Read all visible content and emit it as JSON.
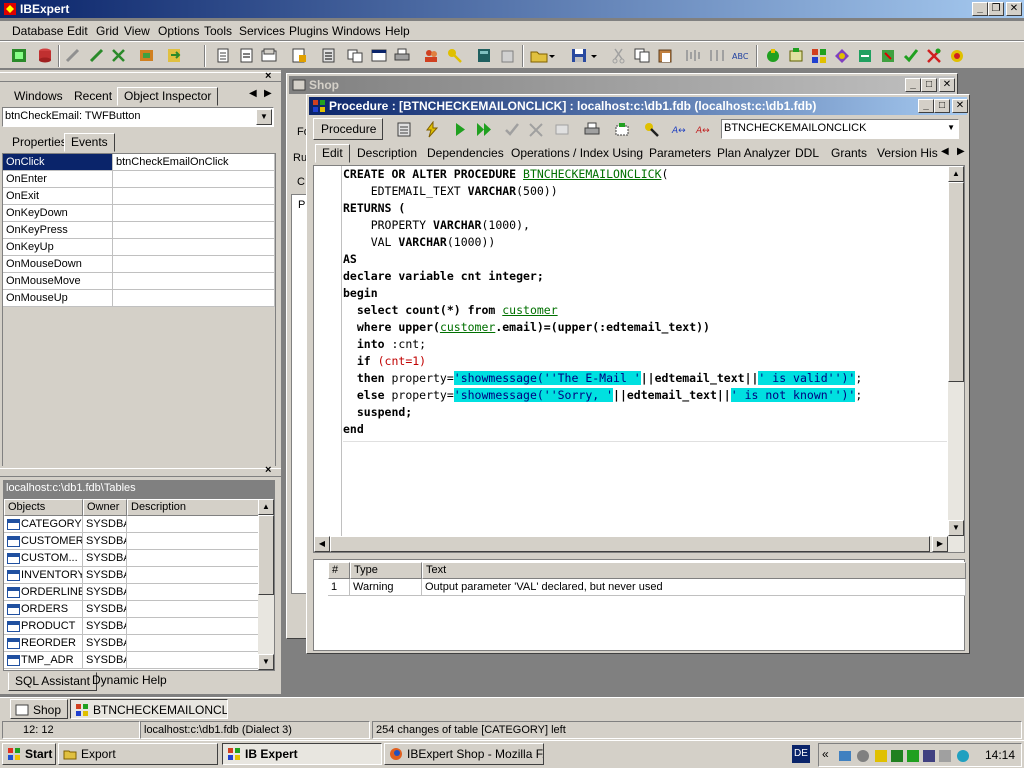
{
  "app": {
    "title": "IBExpert",
    "menu": [
      "Database",
      "Edit",
      "Grid",
      "View",
      "Options",
      "Tools",
      "Services",
      "Plugins",
      "Windows",
      "Help"
    ]
  },
  "inspector": {
    "tabs": [
      "Windows",
      "Recent",
      "Object Inspector"
    ],
    "component": "btnCheckEmail: TWFButton",
    "subtabs": [
      "Properties",
      "Events"
    ],
    "events": [
      {
        "name": "OnClick",
        "value": "btnCheckEmailOnClick"
      },
      {
        "name": "OnEnter",
        "value": ""
      },
      {
        "name": "OnExit",
        "value": ""
      },
      {
        "name": "OnKeyDown",
        "value": ""
      },
      {
        "name": "OnKeyPress",
        "value": ""
      },
      {
        "name": "OnKeyUp",
        "value": ""
      },
      {
        "name": "OnMouseDown",
        "value": ""
      },
      {
        "name": "OnMouseMove",
        "value": ""
      },
      {
        "name": "OnMouseUp",
        "value": ""
      }
    ]
  },
  "db_panel": {
    "path": "localhost:c:\\db1.fdb\\Tables",
    "headers": [
      "Objects",
      "Owner",
      "Description"
    ],
    "rows": [
      {
        "name": "CATEGORY",
        "owner": "SYSDBA"
      },
      {
        "name": "CUSTOMER",
        "owner": "SYSDBA"
      },
      {
        "name": "CUSTOM...",
        "owner": "SYSDBA"
      },
      {
        "name": "INVENTORY",
        "owner": "SYSDBA"
      },
      {
        "name": "ORDERLINE",
        "owner": "SYSDBA"
      },
      {
        "name": "ORDERS",
        "owner": "SYSDBA"
      },
      {
        "name": "PRODUCT",
        "owner": "SYSDBA"
      },
      {
        "name": "REORDER",
        "owner": "SYSDBA"
      },
      {
        "name": "TMP_ADR",
        "owner": "SYSDBA"
      }
    ],
    "bottom_tabs": [
      "SQL Assistant",
      "Dynamic Help"
    ]
  },
  "shop_window": {
    "title": "Shop",
    "left_labels": [
      "Fo",
      "Ru",
      "C",
      "P"
    ]
  },
  "procedure_window": {
    "title": "Procedure : [BTNCHECKEMAILONCLICK] : localhost:c:\\db1.fdb (localhost:c:\\db1.fdb)",
    "procedure_button": "Procedure",
    "name_combo": "BTNCHECKEMAILONCLICK",
    "tabs": [
      "Edit",
      "Description",
      "Dependencies",
      "Operations / Index Using",
      "Parameters",
      "Plan Analyzer",
      "DDL",
      "Grants",
      "Version His"
    ],
    "code": {
      "l1_kw": "CREATE OR ALTER PROCEDURE ",
      "l1_name": "BTNCHECKEMAILONCLICK",
      "l1_paren": "(",
      "l2_a": "    EDTEMAIL_TEXT ",
      "l2_kw": "VARCHAR",
      "l2_b": "(500))",
      "l3": "RETURNS (",
      "l4_a": "    PROPERTY ",
      "l4_kw": "VARCHAR",
      "l4_b": "(1000),",
      "l5_a": "    VAL ",
      "l5_kw": "VARCHAR",
      "l5_b": "(1000))",
      "l6": "AS",
      "l7": "declare variable cnt integer;",
      "l8": "begin",
      "l9_kw": "  select count(*) from ",
      "l9_tbl": "customer",
      "l10_kw": "  where upper(",
      "l10_tbl": "customer",
      "l10_b": ".email)=(upper(:edtemail_text))",
      "l11_kw": "  into ",
      "l11_b": ":cnt;",
      "l12_kw": "  if ",
      "l12_b": "(cnt=1)",
      "l13_kw": "  then ",
      "l13_a": "property=",
      "l13_s1": "'showmessage(''The E-Mail '",
      "l13_b": "||edtemail_text||",
      "l13_s2": "' is valid'')'",
      "l13_c": ";",
      "l14_kw": "  else ",
      "l14_a": "property=",
      "l14_s1": "'showmessage(''Sorry, '",
      "l14_b": "||edtemail_text||",
      "l14_s2": "' is not known'')'",
      "l14_c": ";",
      "l15": "  suspend;",
      "l16": "end"
    },
    "messages": {
      "headers": [
        "#",
        "Type",
        "Text"
      ],
      "rows": [
        {
          "num": "1",
          "type": "Warning",
          "text": "Output parameter 'VAL' declared, but never used"
        }
      ]
    }
  },
  "mdi_tabs": [
    "Shop",
    "BTNCHECKEMAILONCLICK"
  ],
  "status": {
    "position": "12:  12",
    "connection": "localhost:c:\\db1.fdb (Dialect 3)",
    "changes": "254 changes of table [CATEGORY] left"
  },
  "taskbar": {
    "start": "Start",
    "buttons": [
      "Export",
      "IB Expert",
      "IBExpert Shop - Mozilla F..."
    ],
    "lang": "DE",
    "clock": "14:14"
  }
}
